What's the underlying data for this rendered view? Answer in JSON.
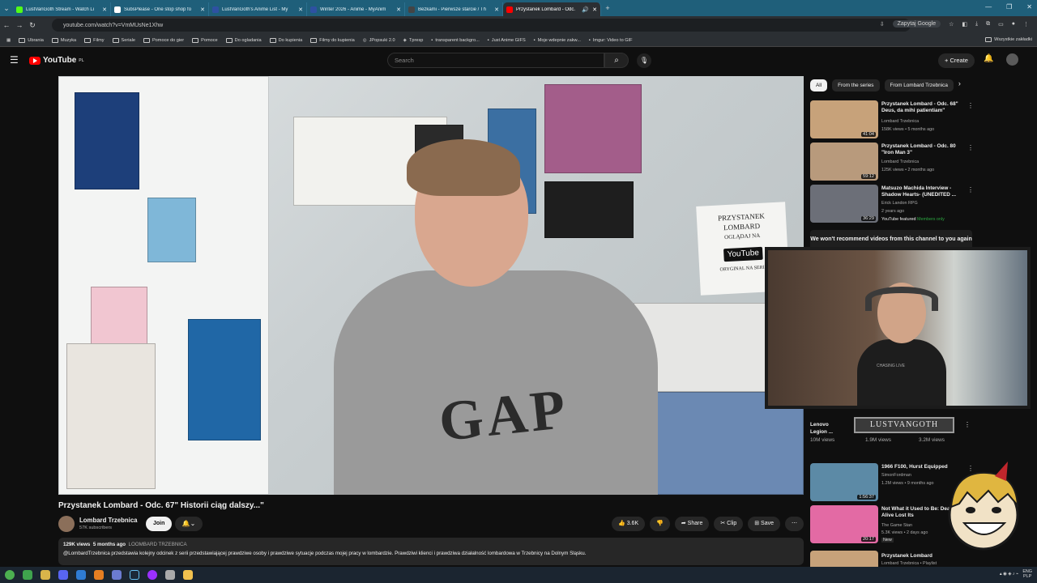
{
  "browser": {
    "tabs": [
      {
        "title": "LustVanGoth Stream - Watch Li",
        "color": "#53fc18"
      },
      {
        "title": "SubsPlease - One stop shop fo",
        "color": "#ffffff"
      },
      {
        "title": "LustVanGoth's Anime List - My",
        "color": "#2e51a2"
      },
      {
        "title": "Winter 2026 - Anime - MyAnim",
        "color": "#2e51a2"
      },
      {
        "title": "Bezkami - Pierwsze starcie / Th",
        "color": "#2a2a2a"
      },
      {
        "title": "Przystanek Lombard - Odc.",
        "color": "#ff0000",
        "active": true
      }
    ],
    "url": "youtube.com/watch?v=VmMUsNe1Xhw",
    "translate_label": "Zapytaj Google",
    "bookmarks": [
      "Ubrania",
      "Muzyka",
      "Filmy",
      "Seriale",
      "Pomoce do gier",
      "Pomoce",
      "Do ogladania",
      "Do kupienia",
      "Filmy do kupienia",
      "JPopsuki 2.0",
      "Tpresp",
      "transparent backgro...",
      "Just Anime GIFS",
      "Moje wdepnie zakw...",
      "Imgur: Video to GIF"
    ],
    "all_bookmarks": "Wszystkie zakładki"
  },
  "youtube": {
    "logo_text": "YouTube",
    "logo_region": "PL",
    "search_placeholder": "Search",
    "create_label": "Create"
  },
  "video": {
    "title": "Przystanek Lombard - Odc. 67\" Historii ciąg dalszy...\"",
    "channel": "Lombard Trzebnica",
    "subscribers": "57K subscribers",
    "join_label": "Join",
    "likes": "3.6K",
    "share_label": "Share",
    "clip_label": "Clip",
    "save_label": "Save",
    "views": "129K views",
    "age": "5 months ago",
    "tag": "LOOMBARD TRZEBNICA",
    "description": "@LombardTrzebnica przedstawia kolejny odcinek z serii przedstawiającej prawdziwe osoby i prawdziwe sytuacje podczas mojej pracy w lombardzie. Prawdziwi klienci i prawdziwa działalność lombardowa w Trzebnicy na Dolnym Śląsku.",
    "scene_sign": {
      "line1": "PRZYSTANEK",
      "line2": "LOMBARD",
      "line3": "OGLĄDAJ NA",
      "yt": "YouTube",
      "line4": "ORYGINAL NA SERIA"
    },
    "shirt_text": "GAP"
  },
  "sidebar": {
    "chips": [
      "All",
      "From the series",
      "From Lombard Trzebnica"
    ],
    "recs": [
      {
        "title": "Przystanek Lombard - Odc. 68\" Deus, da mihi patientiam\"",
        "channel": "Lombard Trzebnica",
        "meta": "158K views • 5 months ago",
        "duration": "41:04",
        "thumb": "#c7a27a"
      },
      {
        "title": "Przystanek Lombard - Odc. 80 \"Iron Man 3\"",
        "channel": "Lombard Trzebnica",
        "meta": "125K views • 2 months ago",
        "duration": "59:12",
        "thumb": "#b89a7c"
      },
      {
        "title": "Matsuzo Machida Interview - Shadow Hearts- (UNEDITED ...",
        "channel": "Erick Landon RPG",
        "meta": "2 years ago",
        "duration": "36:29",
        "thumb": "#6c6f78",
        "featured": "YouTube featured",
        "members": "Members only"
      }
    ],
    "notice": "We won't recommend videos from this channel to you again",
    "shorts": [
      {
        "title": "Lenovo Legion ...",
        "views": "10M views"
      },
      {
        "title": "...",
        "views": "1.9M views"
      },
      {
        "title": "...",
        "views": "3.2M views"
      }
    ],
    "recs2": [
      {
        "title": "1966 F100, Hurst Equipped",
        "channel": "SimonFordman",
        "meta": "1.2M views • 9 months ago",
        "duration": "1:56:37",
        "thumb": "#5c8aa6"
      },
      {
        "title": "Not What it Used to Be: Dead or Alive Lost Its",
        "channel": "The Game Stan",
        "meta": "5.3K views • 2 days ago",
        "badge": "New",
        "duration": "20:17",
        "thumb": "#e36aa4"
      },
      {
        "title": "Przystanek Lombard",
        "channel": "Lombard Trzebnica • Playlist",
        "meta": "",
        "duration": "",
        "thumb": "#c7a27a"
      }
    ]
  },
  "overlay": {
    "streamer_name": "LUSTVANGOTH",
    "shirt_text": "CHASING LIVE"
  },
  "taskbar": {
    "lang": "ENG",
    "lang2": "PLP"
  }
}
